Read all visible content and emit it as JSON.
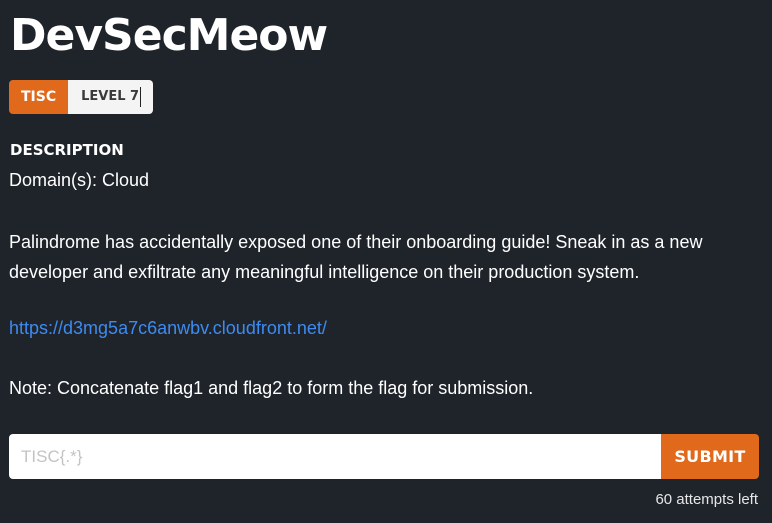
{
  "challenge": {
    "title": "DevSecMeow",
    "category_tag": "TISC",
    "level_tag": "LEVEL 7",
    "description_heading": "DESCRIPTION",
    "domains": "Domain(s): Cloud",
    "description": "Palindrome has accidentally exposed one of their onboarding guide! Sneak in as a new developer and exfiltrate any meaningful intelligence on their production system.",
    "link": "https://d3mg5a7c6anwbv.cloudfront.net/",
    "note": "Note: Concatenate flag1 and flag2 to form the flag for submission."
  },
  "submission": {
    "placeholder": "TISC{.*}",
    "value": "",
    "submit_label": "SUBMIT",
    "attempts_left": "60 attempts left"
  },
  "colors": {
    "background": "#1f242b",
    "accent": "#e0691c",
    "link": "#3d8bf0"
  }
}
